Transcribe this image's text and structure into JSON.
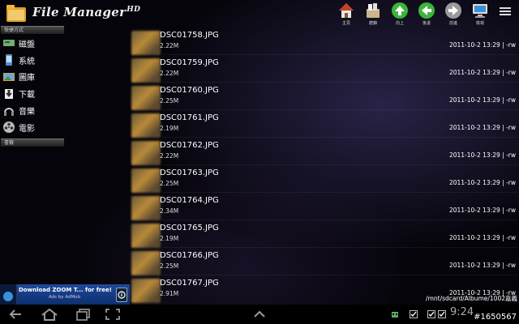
{
  "app": {
    "title": "File Manager",
    "title_suffix": "HD"
  },
  "toolbar": [
    {
      "label": "主頁",
      "icon": "home-icon"
    },
    {
      "label": "磨錦",
      "icon": "bookmark-basket-icon"
    },
    {
      "label": "向上",
      "icon": "up-arrow-icon"
    },
    {
      "label": "後退",
      "icon": "back-arrow-icon"
    },
    {
      "label": "前進",
      "icon": "forward-arrow-icon"
    },
    {
      "label": "檢視",
      "icon": "monitor-icon"
    }
  ],
  "sidebar": {
    "shortcuts_title": "快捷方式",
    "items": [
      {
        "label": "磁盤",
        "icon": "disk-icon"
      },
      {
        "label": "系統",
        "icon": "phone-icon"
      },
      {
        "label": "圖庫",
        "icon": "picture-icon"
      },
      {
        "label": "下載",
        "icon": "download-icon"
      },
      {
        "label": "音樂",
        "icon": "headphones-icon"
      },
      {
        "label": "電影",
        "icon": "film-reel-icon"
      }
    ],
    "second_section_title": "書籤"
  },
  "files": [
    {
      "name": "DSC01758.JPG",
      "size": "2.22M",
      "modified": "2011-10-2 13:29",
      "perm": "-rw"
    },
    {
      "name": "DSC01759.JPG",
      "size": "2.22M",
      "modified": "2011-10-2 13:29",
      "perm": "-rw"
    },
    {
      "name": "DSC01760.JPG",
      "size": "2.25M",
      "modified": "2011-10-2 13:29",
      "perm": "-rw"
    },
    {
      "name": "DSC01761.JPG",
      "size": "2.19M",
      "modified": "2011-10-2 13:29",
      "perm": "-rw"
    },
    {
      "name": "DSC01762.JPG",
      "size": "2.22M",
      "modified": "2011-10-2 13:29",
      "perm": "-rw"
    },
    {
      "name": "DSC01763.JPG",
      "size": "2.25M",
      "modified": "2011-10-2 13:29",
      "perm": "-rw"
    },
    {
      "name": "DSC01764.JPG",
      "size": "2.34M",
      "modified": "2011-10-2 13:29",
      "perm": "-rw"
    },
    {
      "name": "DSC01765.JPG",
      "size": "2.19M",
      "modified": "2011-10-2 13:29",
      "perm": "-rw"
    },
    {
      "name": "DSC01766.JPG",
      "size": "2.25M",
      "modified": "2011-10-2 13:29",
      "perm": "-rw"
    },
    {
      "name": "DSC01767.JPG",
      "size": "2.91M",
      "modified": "2011-10-2 13:29",
      "perm": "-rw"
    }
  ],
  "path": "/mnt/sdcard/Albume/1002嘉義",
  "ad": {
    "title": "Download ZOOM T... for free!",
    "subtitle": "Ads by AdMob"
  },
  "statusbar": {
    "clock": "9:24"
  },
  "watermark": "#1650567",
  "colors": {
    "background": "#05040a",
    "ad_blue": "#1e4a9c",
    "toolbar_green": "#3cb43c"
  }
}
